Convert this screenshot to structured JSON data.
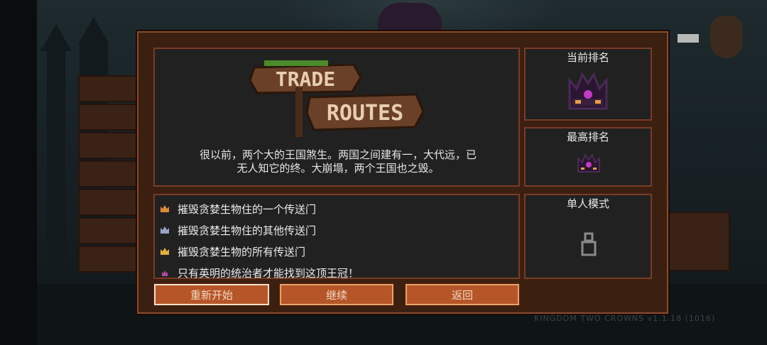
{
  "game": {
    "watermark": "KINGDOM TWO CROWNS v1.1.18 (1016)"
  },
  "logo": {
    "word1": "TRADE",
    "word2": "ROUTES"
  },
  "description": {
    "line1": "很以前，两个大的王国煞生。两国之间建有一，大代远，已",
    "line2": "无人知它的终。大崩塌，两个王国也之毁。"
  },
  "objectives": [
    {
      "text": "摧毁贪婪生物住的一个传送门",
      "crown_color": "#d98a3a"
    },
    {
      "text": "摧毁贪婪生物住的其他传送门",
      "crown_color": "#9aa4c8"
    },
    {
      "text": "摧毁贪婪生物的所有传送门",
      "crown_color": "#e2b03a"
    },
    {
      "text": "只有英明的统治者才能找到这顶王冠！",
      "crown_color": "#b04aa0"
    }
  ],
  "side": {
    "current_rank_label": "当前排名",
    "best_rank_label": "最高排名",
    "mode_label": "单人模式"
  },
  "buttons": {
    "restart": "重新开始",
    "continue": "继续",
    "back": "返回"
  },
  "colors": {
    "panel_bg": "#212121",
    "frame": "#7a3b24",
    "button": "#b65628",
    "crown_dark": "#2a1630",
    "crown_gem": "#c23cc8"
  }
}
